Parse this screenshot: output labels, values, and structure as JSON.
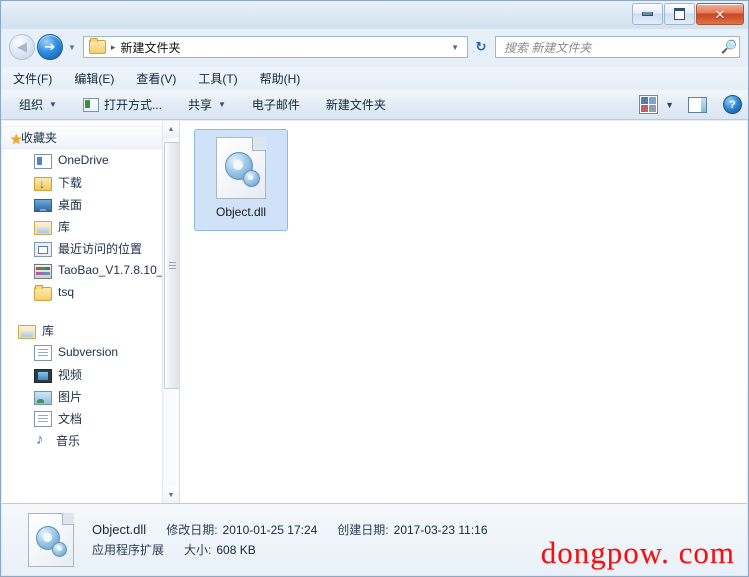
{
  "window": {
    "controls": {
      "minimize": "minimize-button",
      "maximize": "maximize-button",
      "close_glyph": "✕"
    }
  },
  "address_bar": {
    "back_label": "◀",
    "forward_label": "➔",
    "history_caret": "▼",
    "folder_icon": "folder-icon",
    "path_separator": "▸",
    "path_text": "新建文件夹",
    "path_caret": "▼",
    "refresh_glyph": "↻",
    "search_placeholder": "搜索 新建文件夹",
    "search_icon": "🔍"
  },
  "menubar": {
    "items": [
      {
        "label": "文件(F)"
      },
      {
        "label": "编辑(E)"
      },
      {
        "label": "查看(V)"
      },
      {
        "label": "工具(T)"
      },
      {
        "label": "帮助(H)"
      }
    ]
  },
  "toolbar": {
    "organize_label": "组织",
    "open_with_label": "打开方式...",
    "share_label": "共享",
    "email_label": "电子邮件",
    "new_folder_label": "新建文件夹",
    "caret": "▼",
    "view_caret": "▼",
    "help_glyph": "?"
  },
  "navpane": {
    "favorites": {
      "label": "收藏夹",
      "icon": "star-icon",
      "items": [
        {
          "label": "OneDrive",
          "icon": "onedrive-icon"
        },
        {
          "label": "下载",
          "icon": "download-folder-icon"
        },
        {
          "label": "桌面",
          "icon": "desktop-icon"
        },
        {
          "label": "库",
          "icon": "library-icon"
        },
        {
          "label": "最近访问的位置",
          "icon": "recent-places-icon"
        },
        {
          "label": "TaoBao_V1.7.8.10_",
          "icon": "rar-archive-icon"
        },
        {
          "label": "tsq",
          "icon": "folder-icon"
        }
      ]
    },
    "libraries": {
      "label": "库",
      "icon": "library-icon",
      "items": [
        {
          "label": "Subversion",
          "icon": "document-icon"
        },
        {
          "label": "视频",
          "icon": "video-icon"
        },
        {
          "label": "图片",
          "icon": "picture-icon"
        },
        {
          "label": "文档",
          "icon": "document-icon"
        },
        {
          "label": "音乐",
          "icon": "music-icon"
        }
      ]
    },
    "scrollbar": {
      "up_glyph": "▲",
      "down_glyph": "▼"
    }
  },
  "content": {
    "files": [
      {
        "name": "Object.dll",
        "icon": "dll-file-icon",
        "selected": true
      }
    ]
  },
  "details_pane": {
    "file_name": "Object.dll",
    "file_type": "应用程序扩展",
    "modified_label": "修改日期:",
    "modified_value": "2010-01-25 17:24",
    "created_label": "创建日期:",
    "created_value": "2017-03-23 11:16",
    "size_label": "大小:",
    "size_value": "608 KB"
  },
  "watermark": {
    "text": "dongpow. com",
    "color": "#f01010"
  }
}
